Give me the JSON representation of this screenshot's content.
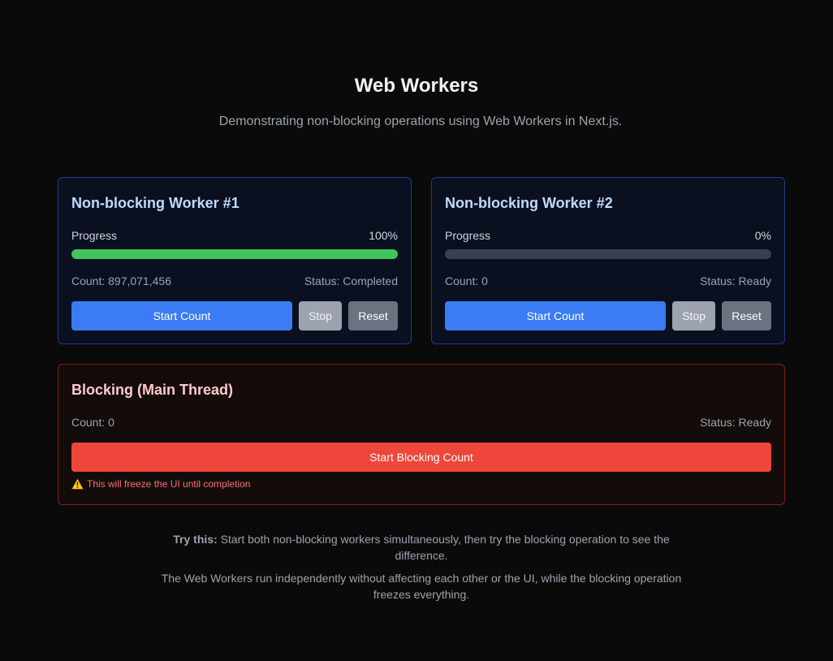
{
  "header": {
    "title": "Web Workers",
    "subtitle": "Demonstrating non-blocking operations using Web Workers in Next.js."
  },
  "workers": [
    {
      "title": "Non-blocking Worker #1",
      "progress_label": "Progress",
      "progress_text": "100%",
      "progress_value": 100,
      "count_text": "Count: 897,071,456",
      "status_text": "Status: Completed",
      "start_label": "Start Count",
      "stop_label": "Stop",
      "reset_label": "Reset"
    },
    {
      "title": "Non-blocking Worker #2",
      "progress_label": "Progress",
      "progress_text": "0%",
      "progress_value": 0,
      "count_text": "Count: 0",
      "status_text": "Status: Ready",
      "start_label": "Start Count",
      "stop_label": "Stop",
      "reset_label": "Reset"
    }
  ],
  "blocking": {
    "title": "Blocking (Main Thread)",
    "count_text": "Count: 0",
    "status_text": "Status: Ready",
    "button_label": "Start Blocking Count",
    "warning_icon": "warning-icon",
    "warning_text": "This will freeze the UI until completion"
  },
  "notes": {
    "try_lead": "Try this:",
    "try_text": "Start both non-blocking workers simultaneously, then try the blocking operation to see the difference.",
    "explain_text": "The Web Workers run independently without affecting each other or the UI, while the blocking operation freezes everything."
  },
  "colors": {
    "background": "#0a0a0a",
    "worker_border": "#1e3a8a",
    "blocking_border": "#7f1d1d",
    "progress_fill": "#3fc55a",
    "progress_track": "#374151",
    "start_button": "#3b7bf6",
    "stop_button": "#9ca3af",
    "reset_button": "#6b7280",
    "blocking_button": "#ef463b",
    "warning_text": "#f87171"
  }
}
